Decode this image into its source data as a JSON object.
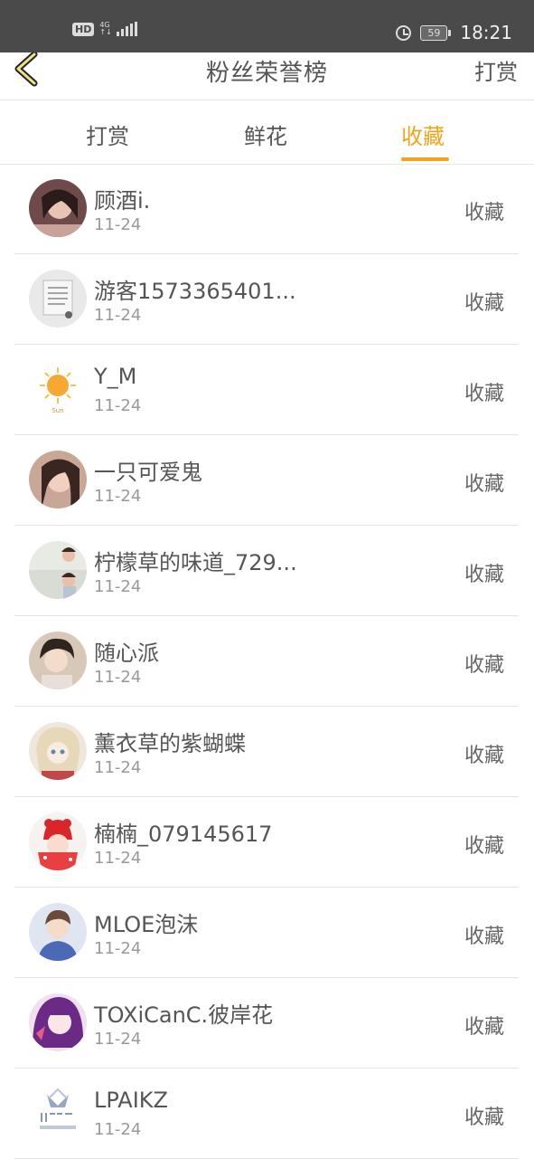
{
  "status_bar": {
    "hd": "HD",
    "network": "4G",
    "battery": "59",
    "time": "18:21"
  },
  "header": {
    "title": "粉丝荣誉榜",
    "action": "打赏"
  },
  "tabs": [
    {
      "label": "打赏",
      "active": false
    },
    {
      "label": "鲜花",
      "active": false
    },
    {
      "label": "收藏",
      "active": true
    }
  ],
  "accent_color": "#f0a41c",
  "items": [
    {
      "name": "顾酒i.",
      "date": "11-24",
      "tag": "收藏"
    },
    {
      "name": "游客1573365401...",
      "date": "11-24",
      "tag": "收藏"
    },
    {
      "name": "Y_M",
      "date": "11-24",
      "tag": "收藏"
    },
    {
      "name": "一只可爱鬼",
      "date": "11-24",
      "tag": "收藏"
    },
    {
      "name": "柠檬草的味道_729...",
      "date": "11-24",
      "tag": "收藏"
    },
    {
      "name": "随心派",
      "date": "11-24",
      "tag": "收藏"
    },
    {
      "name": "薰衣草的紫蝴蝶",
      "date": "11-24",
      "tag": "收藏"
    },
    {
      "name": "楠楠_079145617",
      "date": "11-24",
      "tag": "收藏"
    },
    {
      "name": "MLOE泡沫",
      "date": "11-24",
      "tag": "收藏"
    },
    {
      "name": "TOXiCanC.彼岸花",
      "date": "11-24",
      "tag": "收藏"
    },
    {
      "name": "LPAIKZ",
      "date": "11-24",
      "tag": "收藏"
    }
  ]
}
